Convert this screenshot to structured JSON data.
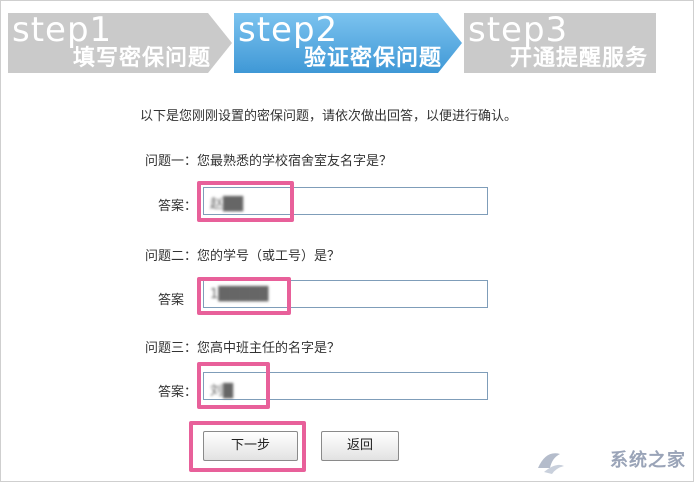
{
  "steps": [
    {
      "num": "step1",
      "title": "填写密保问题",
      "state": "inactive"
    },
    {
      "num": "step2",
      "title": "验证密保问题",
      "state": "active"
    },
    {
      "num": "step3",
      "title": "开通提醒服务",
      "state": "inactive"
    }
  ],
  "colors": {
    "active": "#5aaee0",
    "inactive": "#c9c9c9",
    "highlight": "#e8609a"
  },
  "intro": "以下是您刚刚设置的密保问题，请依次做出回答，以便进行确认。",
  "questions": [
    {
      "label": "问题一：您最熟悉的学校宿舍室友名字是？",
      "answer_label": "答案：",
      "answer": "赵██"
    },
    {
      "label": "问题二：您的学号（或工号）是？",
      "answer_label": "答案",
      "answer": "1█████"
    },
    {
      "label": "问题三：您高中班主任的名字是？",
      "answer_label": "答案：",
      "answer": "刘█"
    }
  ],
  "buttons": {
    "next": "下一步",
    "back": "返回"
  },
  "watermark": "系统之家"
}
